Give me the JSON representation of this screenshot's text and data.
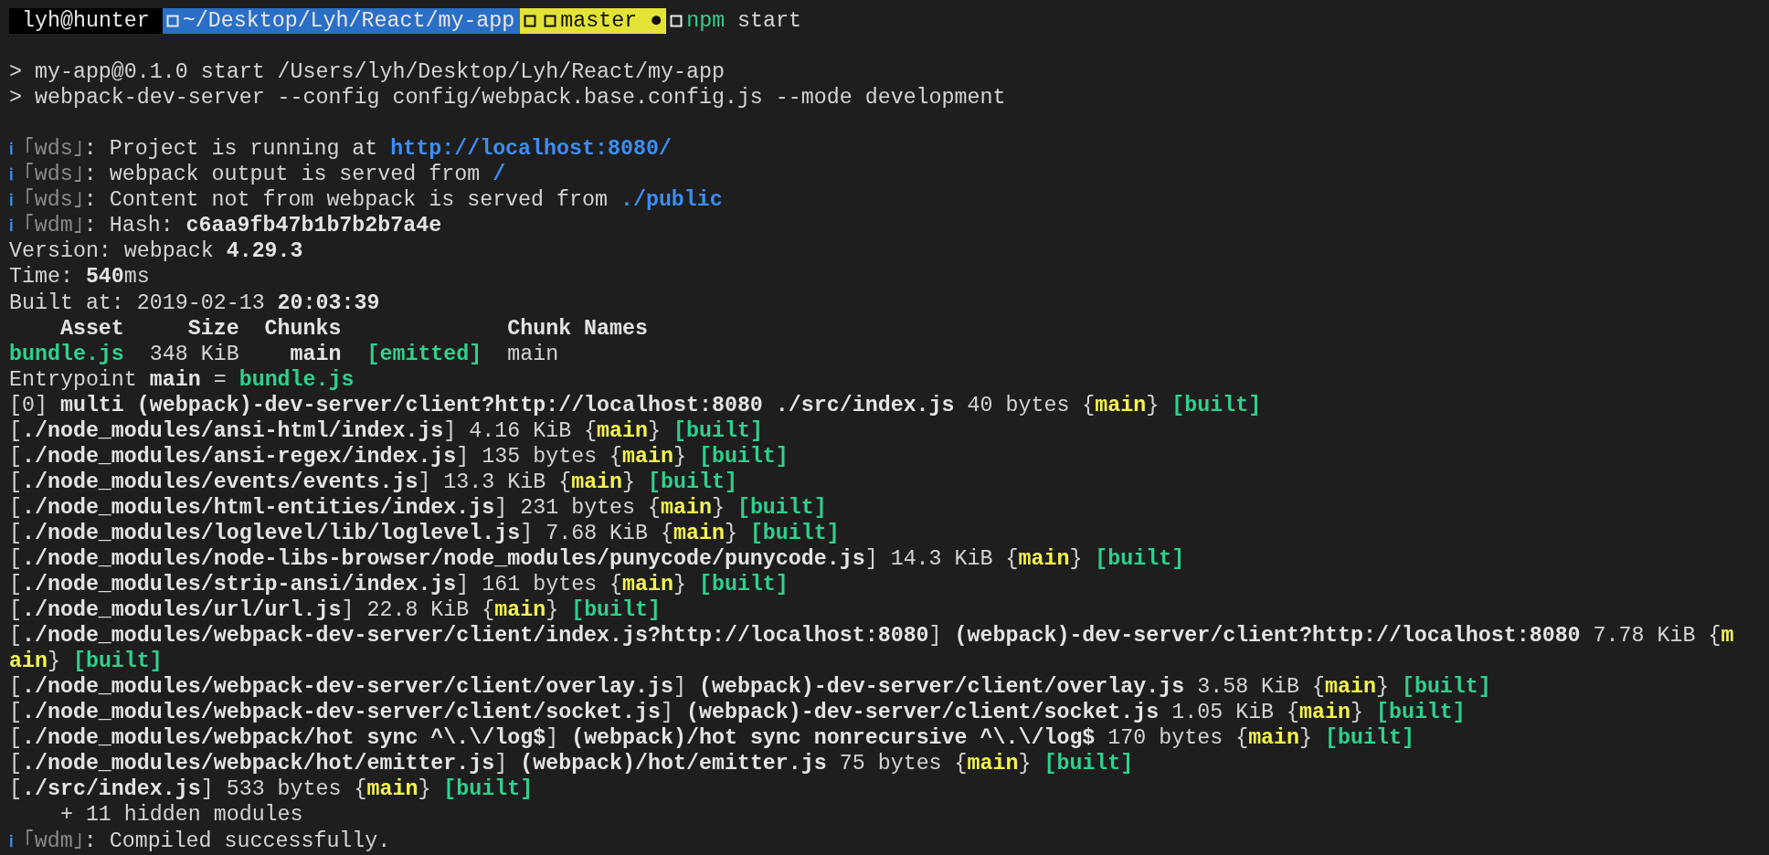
{
  "prompt": {
    "user": "lyh@hunter",
    "path": "~/Desktop/Lyh/React/my-app",
    "branch": "master",
    "dirty_mark": "●",
    "command": "npm",
    "argument": "start"
  },
  "lines": [
    {
      "kind": "blank"
    },
    {
      "kind": "text",
      "segments": [
        {
          "text": "> my-app@0.1.0 start /Users/lyh/Desktop/Lyh/React/my-app",
          "kind": "plain"
        }
      ]
    },
    {
      "kind": "text",
      "segments": [
        {
          "text": "> webpack-dev-server --config config/webpack.base.config.js --mode development",
          "kind": "plain"
        }
      ]
    },
    {
      "kind": "blank"
    },
    {
      "kind": "text",
      "segments": [
        {
          "text": "ℹ ",
          "kind": "info"
        },
        {
          "text": "｢wds｣",
          "kind": "tag"
        },
        {
          "text": ": Project is running at ",
          "kind": "plain"
        },
        {
          "text": "http://localhost:8080/",
          "kind": "blue"
        }
      ]
    },
    {
      "kind": "text",
      "segments": [
        {
          "text": "ℹ ",
          "kind": "info"
        },
        {
          "text": "｢wds｣",
          "kind": "tag"
        },
        {
          "text": ": webpack output is served from ",
          "kind": "plain"
        },
        {
          "text": "/",
          "kind": "blue"
        }
      ]
    },
    {
      "kind": "text",
      "segments": [
        {
          "text": "ℹ ",
          "kind": "info"
        },
        {
          "text": "｢wds｣",
          "kind": "tag"
        },
        {
          "text": ": Content not from webpack is served from ",
          "kind": "plain"
        },
        {
          "text": "./public",
          "kind": "blue"
        }
      ]
    },
    {
      "kind": "text",
      "segments": [
        {
          "text": "ℹ ",
          "kind": "info"
        },
        {
          "text": "｢wdm｣",
          "kind": "tag"
        },
        {
          "text": ": Hash: ",
          "kind": "plain"
        },
        {
          "text": "c6aa9fb47b1b7b2b7a4e",
          "kind": "bold"
        }
      ]
    },
    {
      "kind": "text",
      "segments": [
        {
          "text": "Version: webpack ",
          "kind": "plain"
        },
        {
          "text": "4.29.3",
          "kind": "bold"
        }
      ]
    },
    {
      "kind": "text",
      "segments": [
        {
          "text": "Time: ",
          "kind": "plain"
        },
        {
          "text": "540",
          "kind": "bold"
        },
        {
          "text": "ms",
          "kind": "plain"
        }
      ]
    },
    {
      "kind": "text",
      "segments": [
        {
          "text": "Built at: 2019-02-13 ",
          "kind": "plain"
        },
        {
          "text": "20:03:39",
          "kind": "bold"
        }
      ]
    },
    {
      "kind": "text",
      "segments": [
        {
          "text": "    Asset     Size  Chunks             Chunk Names",
          "kind": "bold"
        }
      ]
    },
    {
      "kind": "text",
      "segments": [
        {
          "text": "bundle.js",
          "kind": "green"
        },
        {
          "text": "  348 KiB    ",
          "kind": "plain"
        },
        {
          "text": "main  ",
          "kind": "bold"
        },
        {
          "text": "[emitted]",
          "kind": "green"
        },
        {
          "text": "  main",
          "kind": "plain"
        }
      ]
    },
    {
      "kind": "text",
      "segments": [
        {
          "text": "Entrypoint ",
          "kind": "plain"
        },
        {
          "text": "main",
          "kind": "bold"
        },
        {
          "text": " = ",
          "kind": "plain"
        },
        {
          "text": "bundle.js",
          "kind": "green"
        }
      ]
    },
    {
      "kind": "text",
      "segments": [
        {
          "text": "[0] ",
          "kind": "plain"
        },
        {
          "text": "multi (webpack)-dev-server/client?http://localhost:8080 ./src/index.js",
          "kind": "bold"
        },
        {
          "text": " 40 bytes {",
          "kind": "plain"
        },
        {
          "text": "main",
          "kind": "yellow"
        },
        {
          "text": "} ",
          "kind": "plain"
        },
        {
          "text": "[built]",
          "kind": "green"
        }
      ]
    },
    {
      "kind": "text",
      "segments": [
        {
          "text": "[",
          "kind": "plain"
        },
        {
          "text": "./node_modules/ansi-html/index.js",
          "kind": "bold"
        },
        {
          "text": "] 4.16 KiB {",
          "kind": "plain"
        },
        {
          "text": "main",
          "kind": "yellow"
        },
        {
          "text": "} ",
          "kind": "plain"
        },
        {
          "text": "[built]",
          "kind": "green"
        }
      ]
    },
    {
      "kind": "text",
      "segments": [
        {
          "text": "[",
          "kind": "plain"
        },
        {
          "text": "./node_modules/ansi-regex/index.js",
          "kind": "bold"
        },
        {
          "text": "] 135 bytes {",
          "kind": "plain"
        },
        {
          "text": "main",
          "kind": "yellow"
        },
        {
          "text": "} ",
          "kind": "plain"
        },
        {
          "text": "[built]",
          "kind": "green"
        }
      ]
    },
    {
      "kind": "text",
      "segments": [
        {
          "text": "[",
          "kind": "plain"
        },
        {
          "text": "./node_modules/events/events.js",
          "kind": "bold"
        },
        {
          "text": "] 13.3 KiB {",
          "kind": "plain"
        },
        {
          "text": "main",
          "kind": "yellow"
        },
        {
          "text": "} ",
          "kind": "plain"
        },
        {
          "text": "[built]",
          "kind": "green"
        }
      ]
    },
    {
      "kind": "text",
      "segments": [
        {
          "text": "[",
          "kind": "plain"
        },
        {
          "text": "./node_modules/html-entities/index.js",
          "kind": "bold"
        },
        {
          "text": "] 231 bytes {",
          "kind": "plain"
        },
        {
          "text": "main",
          "kind": "yellow"
        },
        {
          "text": "} ",
          "kind": "plain"
        },
        {
          "text": "[built]",
          "kind": "green"
        }
      ]
    },
    {
      "kind": "text",
      "segments": [
        {
          "text": "[",
          "kind": "plain"
        },
        {
          "text": "./node_modules/loglevel/lib/loglevel.js",
          "kind": "bold"
        },
        {
          "text": "] 7.68 KiB {",
          "kind": "plain"
        },
        {
          "text": "main",
          "kind": "yellow"
        },
        {
          "text": "} ",
          "kind": "plain"
        },
        {
          "text": "[built]",
          "kind": "green"
        }
      ]
    },
    {
      "kind": "text",
      "segments": [
        {
          "text": "[",
          "kind": "plain"
        },
        {
          "text": "./node_modules/node-libs-browser/node_modules/punycode/punycode.js",
          "kind": "bold"
        },
        {
          "text": "] 14.3 KiB {",
          "kind": "plain"
        },
        {
          "text": "main",
          "kind": "yellow"
        },
        {
          "text": "} ",
          "kind": "plain"
        },
        {
          "text": "[built]",
          "kind": "green"
        }
      ]
    },
    {
      "kind": "text",
      "segments": [
        {
          "text": "[",
          "kind": "plain"
        },
        {
          "text": "./node_modules/strip-ansi/index.js",
          "kind": "bold"
        },
        {
          "text": "] 161 bytes {",
          "kind": "plain"
        },
        {
          "text": "main",
          "kind": "yellow"
        },
        {
          "text": "} ",
          "kind": "plain"
        },
        {
          "text": "[built]",
          "kind": "green"
        }
      ]
    },
    {
      "kind": "text",
      "segments": [
        {
          "text": "[",
          "kind": "plain"
        },
        {
          "text": "./node_modules/url/url.js",
          "kind": "bold"
        },
        {
          "text": "] 22.8 KiB {",
          "kind": "plain"
        },
        {
          "text": "main",
          "kind": "yellow"
        },
        {
          "text": "} ",
          "kind": "plain"
        },
        {
          "text": "[built]",
          "kind": "green"
        }
      ]
    },
    {
      "kind": "text",
      "segments": [
        {
          "text": "[",
          "kind": "plain"
        },
        {
          "text": "./node_modules/webpack-dev-server/client/index.js?http://localhost:8080",
          "kind": "bold"
        },
        {
          "text": "] ",
          "kind": "plain"
        },
        {
          "text": "(webpack)-dev-server/client?http://localhost:8080",
          "kind": "bold"
        },
        {
          "text": " 7.78 KiB {",
          "kind": "plain"
        },
        {
          "text": "m",
          "kind": "yellow"
        }
      ]
    },
    {
      "kind": "text",
      "segments": [
        {
          "text": "ain",
          "kind": "yellow"
        },
        {
          "text": "} ",
          "kind": "plain"
        },
        {
          "text": "[built]",
          "kind": "green"
        }
      ]
    },
    {
      "kind": "text",
      "segments": [
        {
          "text": "[",
          "kind": "plain"
        },
        {
          "text": "./node_modules/webpack-dev-server/client/overlay.js",
          "kind": "bold"
        },
        {
          "text": "] ",
          "kind": "plain"
        },
        {
          "text": "(webpack)-dev-server/client/overlay.js",
          "kind": "bold"
        },
        {
          "text": " 3.58 KiB {",
          "kind": "plain"
        },
        {
          "text": "main",
          "kind": "yellow"
        },
        {
          "text": "} ",
          "kind": "plain"
        },
        {
          "text": "[built]",
          "kind": "green"
        }
      ]
    },
    {
      "kind": "text",
      "segments": [
        {
          "text": "[",
          "kind": "plain"
        },
        {
          "text": "./node_modules/webpack-dev-server/client/socket.js",
          "kind": "bold"
        },
        {
          "text": "] ",
          "kind": "plain"
        },
        {
          "text": "(webpack)-dev-server/client/socket.js",
          "kind": "bold"
        },
        {
          "text": " 1.05 KiB {",
          "kind": "plain"
        },
        {
          "text": "main",
          "kind": "yellow"
        },
        {
          "text": "} ",
          "kind": "plain"
        },
        {
          "text": "[built]",
          "kind": "green"
        }
      ]
    },
    {
      "kind": "text",
      "segments": [
        {
          "text": "[",
          "kind": "plain"
        },
        {
          "text": "./node_modules/webpack/hot sync ^\\.\\/log$",
          "kind": "bold"
        },
        {
          "text": "] ",
          "kind": "plain"
        },
        {
          "text": "(webpack)/hot sync nonrecursive ^\\.\\/log$",
          "kind": "bold"
        },
        {
          "text": " 170 bytes {",
          "kind": "plain"
        },
        {
          "text": "main",
          "kind": "yellow"
        },
        {
          "text": "} ",
          "kind": "plain"
        },
        {
          "text": "[built]",
          "kind": "green"
        }
      ]
    },
    {
      "kind": "text",
      "segments": [
        {
          "text": "[",
          "kind": "plain"
        },
        {
          "text": "./node_modules/webpack/hot/emitter.js",
          "kind": "bold"
        },
        {
          "text": "] ",
          "kind": "plain"
        },
        {
          "text": "(webpack)/hot/emitter.js",
          "kind": "bold"
        },
        {
          "text": " 75 bytes {",
          "kind": "plain"
        },
        {
          "text": "main",
          "kind": "yellow"
        },
        {
          "text": "} ",
          "kind": "plain"
        },
        {
          "text": "[built]",
          "kind": "green"
        }
      ]
    },
    {
      "kind": "text",
      "segments": [
        {
          "text": "[",
          "kind": "plain"
        },
        {
          "text": "./src/index.js",
          "kind": "bold"
        },
        {
          "text": "] 533 bytes {",
          "kind": "plain"
        },
        {
          "text": "main",
          "kind": "yellow"
        },
        {
          "text": "} ",
          "kind": "plain"
        },
        {
          "text": "[built]",
          "kind": "green"
        }
      ]
    },
    {
      "kind": "text",
      "segments": [
        {
          "text": "    + 11 hidden modules",
          "kind": "plain"
        }
      ]
    },
    {
      "kind": "text",
      "segments": [
        {
          "text": "ℹ ",
          "kind": "info"
        },
        {
          "text": "｢wdm｣",
          "kind": "tag"
        },
        {
          "text": ": Compiled successfully.",
          "kind": "plain"
        }
      ]
    }
  ]
}
